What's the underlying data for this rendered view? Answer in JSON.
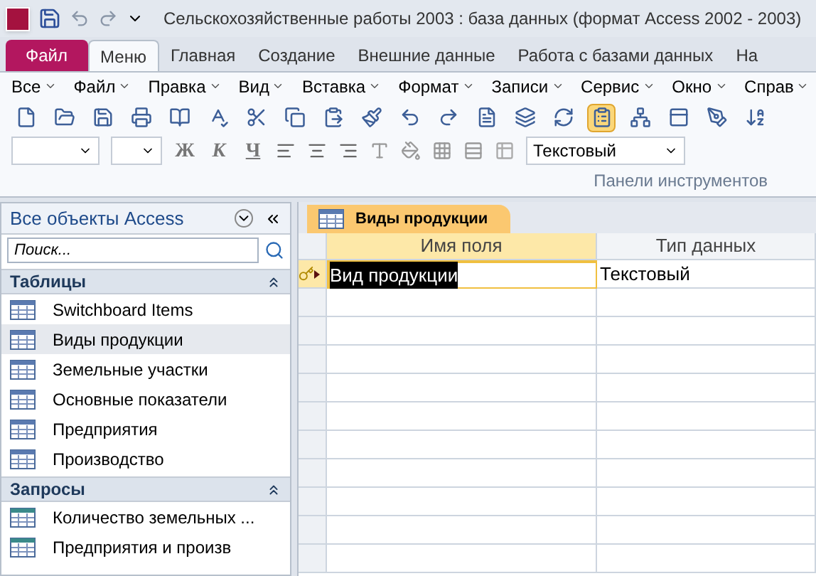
{
  "window": {
    "title": "Сельскохозяйственные работы 2003 : база данных (формат Access 2002 - 2003)"
  },
  "ribbon_tabs": [
    {
      "label": "Файл",
      "kind": "file",
      "selected": false
    },
    {
      "label": "Меню",
      "kind": "tab",
      "selected": true
    },
    {
      "label": "Главная",
      "kind": "tab",
      "selected": false
    },
    {
      "label": "Создание",
      "kind": "tab",
      "selected": false
    },
    {
      "label": "Внешние данные",
      "kind": "tab",
      "selected": false
    },
    {
      "label": "Работа с базами данных",
      "kind": "tab",
      "selected": false
    },
    {
      "label": "На",
      "kind": "tab",
      "selected": false
    }
  ],
  "menu_items": [
    "Все",
    "Файл",
    "Правка",
    "Вид",
    "Вставка",
    "Формат",
    "Записи",
    "Сервис",
    "Окно",
    "Справ"
  ],
  "toolbar": {
    "buttons": [
      {
        "pressed": false
      },
      {
        "pressed": false
      },
      {
        "pressed": false
      },
      {
        "pressed": false
      },
      {
        "pressed": false
      },
      {
        "pressed": false
      },
      {
        "pressed": false
      },
      {
        "pressed": false
      },
      {
        "pressed": false
      },
      {
        "pressed": false
      },
      {
        "pressed": false
      },
      {
        "pressed": false
      },
      {
        "pressed": false
      },
      {
        "pressed": false
      },
      {
        "pressed": false
      },
      {
        "pressed": true
      },
      {
        "pressed": false
      },
      {
        "pressed": false
      },
      {
        "pressed": false
      },
      {
        "pressed": false
      }
    ],
    "format_letters": [
      "Ж",
      "К",
      "Ч"
    ],
    "data_type_combo": "Текстовый",
    "group_label": "Панели инструментов"
  },
  "nav_pane": {
    "title": "Все объекты Access",
    "search": {
      "placeholder": "Поиск..."
    },
    "groups": [
      {
        "title": "Таблицы",
        "expanded": true,
        "items": [
          {
            "label": "Switchboard Items",
            "kind": "table",
            "selected": false
          },
          {
            "label": "Виды продукции",
            "kind": "table",
            "selected": true
          },
          {
            "label": "Земельные участки",
            "kind": "table",
            "selected": false
          },
          {
            "label": "Основные показатели",
            "kind": "table",
            "selected": false
          },
          {
            "label": "Предприятия",
            "kind": "table",
            "selected": false
          },
          {
            "label": "Производство",
            "kind": "table",
            "selected": false
          }
        ]
      },
      {
        "title": "Запросы",
        "expanded": true,
        "items": [
          {
            "label": "Количество земельных ...",
            "kind": "query",
            "selected": false
          },
          {
            "label": "Предприятия и произв",
            "kind": "query",
            "selected": false
          }
        ]
      }
    ]
  },
  "document": {
    "tabs": [
      {
        "label": "Виды продукции",
        "selected": true
      }
    ],
    "table": {
      "columns": [
        {
          "label": "Имя поля",
          "selected": true
        },
        {
          "label": "Тип данных",
          "selected": false
        }
      ],
      "rows": [
        {
          "cells": [
            "Вид продукции",
            "Текстовый"
          ],
          "primary_key": true,
          "current": true
        }
      ]
    }
  }
}
